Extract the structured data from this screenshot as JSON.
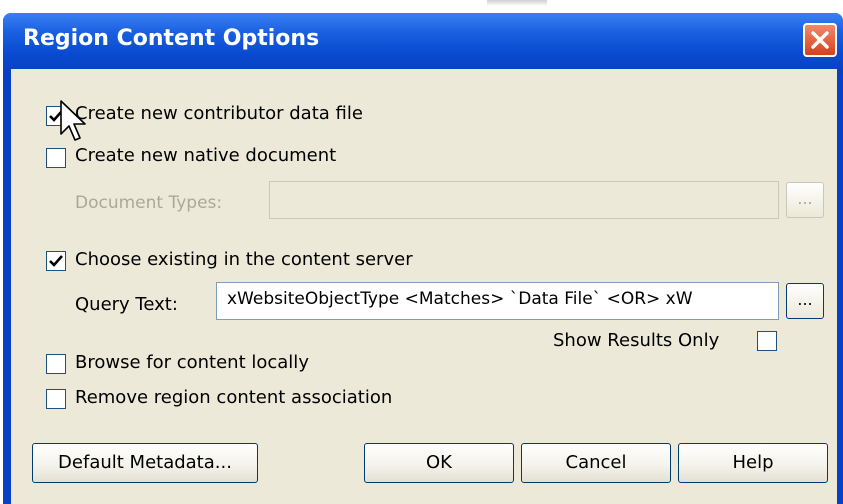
{
  "window": {
    "title": "Region Content Options"
  },
  "options": {
    "create_contributor": {
      "label": "Create new contributor data file",
      "checked": true
    },
    "create_native": {
      "label": "Create new native document",
      "checked": false
    },
    "document_types": {
      "label": "Document Types:",
      "value": "",
      "browse_label": "...",
      "enabled": false
    },
    "choose_existing": {
      "label": "Choose existing in the content server",
      "checked": true
    },
    "query_text": {
      "label": "Query Text:",
      "value": "xWebsiteObjectType <Matches> `Data File` <OR> xW",
      "browse_label": "..."
    },
    "show_results_only": {
      "label": "Show Results Only",
      "checked": false
    },
    "browse_local": {
      "label": "Browse for content locally",
      "checked": false
    },
    "remove_association": {
      "label": "Remove region content association",
      "checked": false
    }
  },
  "buttons": {
    "default_metadata": "Default Metadata...",
    "ok": "OK",
    "cancel": "Cancel",
    "help": "Help"
  },
  "icons": {
    "close": "close-icon",
    "checkmark": "checkmark-icon",
    "cursor": "mouse-pointer-icon"
  },
  "colors": {
    "titlebar": "#0a4bd2",
    "close_button": "#d8401c",
    "client_background": "#ece9d8",
    "disabled_text": "#aca899"
  }
}
